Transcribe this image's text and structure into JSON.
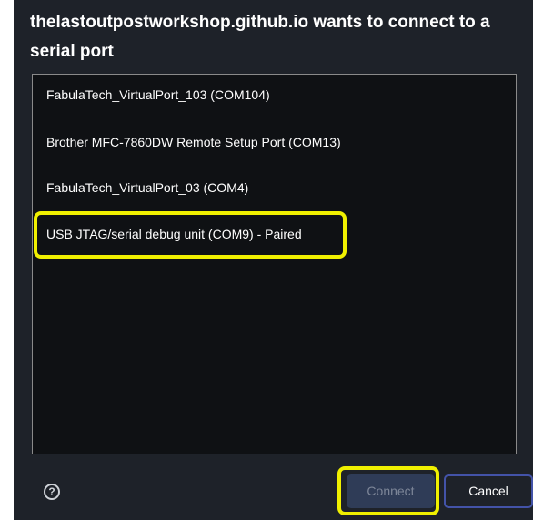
{
  "dialog": {
    "title": "thelastoutpostworkshop.github.io wants to connect to a serial port"
  },
  "ports": [
    {
      "label": "FabulaTech_VirtualPort_103 (COM104)"
    },
    {
      "label": "Brother MFC-7860DW Remote Setup Port (COM13)"
    },
    {
      "label": "FabulaTech_VirtualPort_03 (COM4)"
    },
    {
      "label": "USB JTAG/serial debug unit (COM9) - Paired"
    }
  ],
  "footer": {
    "help_icon": "question-circle-icon",
    "help_glyph": "?",
    "connect_label": "Connect",
    "cancel_label": "Cancel"
  },
  "colors": {
    "dialog_bg": "#1e2229",
    "list_bg": "#0f1114",
    "highlight": "#f0f000",
    "cancel_border": "#4353a8",
    "connect_bg": "#2f3c57"
  }
}
